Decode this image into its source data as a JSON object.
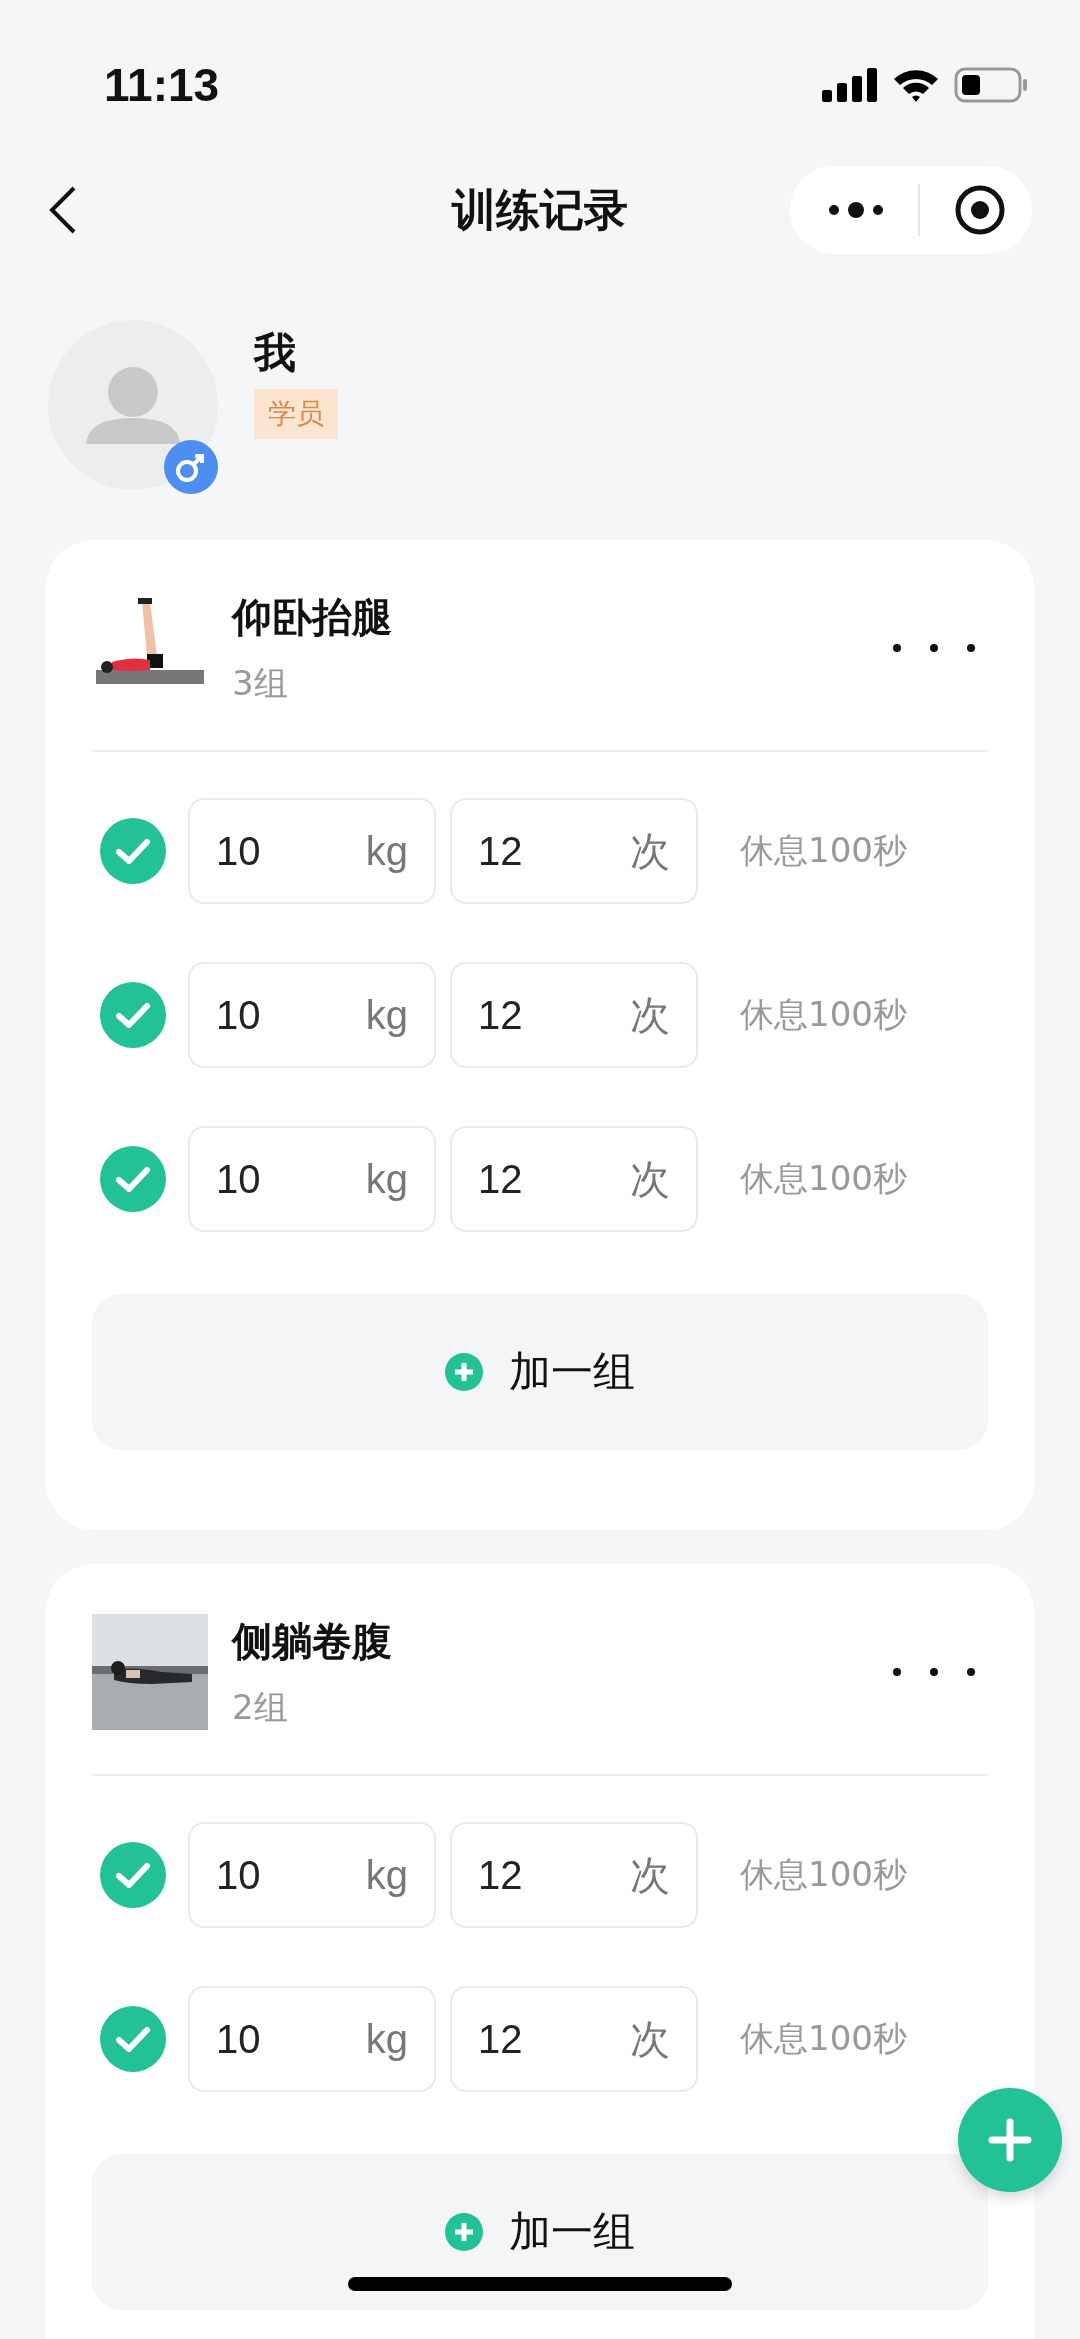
{
  "status_bar": {
    "time": "11:13"
  },
  "nav": {
    "title": "训练记录"
  },
  "profile": {
    "name": "我",
    "tag": "学员"
  },
  "exercises": [
    {
      "name": "仰卧抬腿",
      "sets_count": "3组",
      "sets": [
        {
          "checked": true,
          "weight": "10",
          "weight_unit": "kg",
          "reps": "12",
          "reps_unit": "次",
          "rest": "休息100秒"
        },
        {
          "checked": true,
          "weight": "10",
          "weight_unit": "kg",
          "reps": "12",
          "reps_unit": "次",
          "rest": "休息100秒"
        },
        {
          "checked": true,
          "weight": "10",
          "weight_unit": "kg",
          "reps": "12",
          "reps_unit": "次",
          "rest": "休息100秒"
        }
      ],
      "add_button": "加一组"
    },
    {
      "name": "侧躺卷腹",
      "sets_count": "2组",
      "sets": [
        {
          "checked": true,
          "weight": "10",
          "weight_unit": "kg",
          "reps": "12",
          "reps_unit": "次",
          "rest": "休息100秒"
        },
        {
          "checked": true,
          "weight": "10",
          "weight_unit": "kg",
          "reps": "12",
          "reps_unit": "次",
          "rest": "休息100秒"
        }
      ],
      "add_button": "加一组"
    }
  ]
}
